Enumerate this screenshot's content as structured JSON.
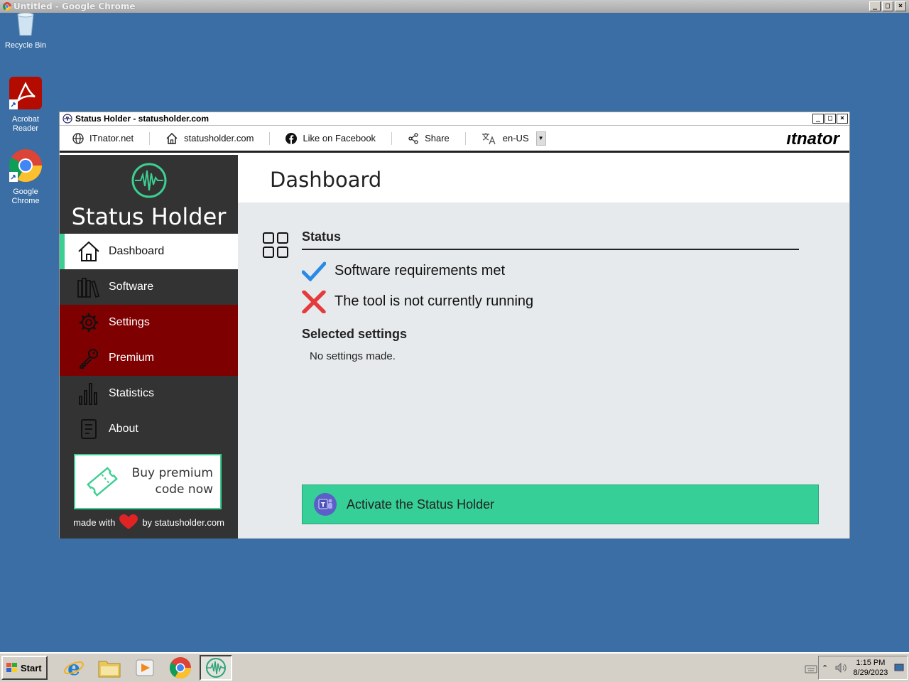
{
  "browser": {
    "title": "Untitled - Google Chrome"
  },
  "desktop": {
    "icons": [
      {
        "label": "Recycle Bin"
      },
      {
        "label": "Acrobat Reader"
      },
      {
        "label": "Google Chrome"
      }
    ]
  },
  "app": {
    "title": "Status Holder - statusholder.com",
    "toolbar": {
      "itnator_link": "ITnator.net",
      "home_link": "statusholder.com",
      "facebook_link": "Like on Facebook",
      "share_link": "Share",
      "language": "en-US",
      "brand": "ıtnator"
    },
    "sidebar": {
      "logo_name": "Status Holder",
      "items": [
        {
          "label": "Dashboard"
        },
        {
          "label": "Software"
        },
        {
          "label": "Settings"
        },
        {
          "label": "Premium"
        },
        {
          "label": "Statistics"
        },
        {
          "label": "About"
        }
      ],
      "buy_line1": "Buy premium",
      "buy_line2": "code now",
      "made_with": "made with",
      "by_text": "by statusholder.com"
    },
    "main": {
      "page_title": "Dashboard",
      "status_title": "Status",
      "status_ok": "Software requirements met",
      "status_fail": "The tool is not currently running",
      "selected_title": "Selected settings",
      "selected_text": "No settings made.",
      "activate_label": "Activate the Status Holder"
    },
    "colors": {
      "accent": "#36cf97",
      "sidebar": "#333333",
      "premium_red": "#7f0000"
    }
  },
  "taskbar": {
    "start_label": "Start",
    "time": "1:15 PM",
    "date": "8/29/2023"
  }
}
